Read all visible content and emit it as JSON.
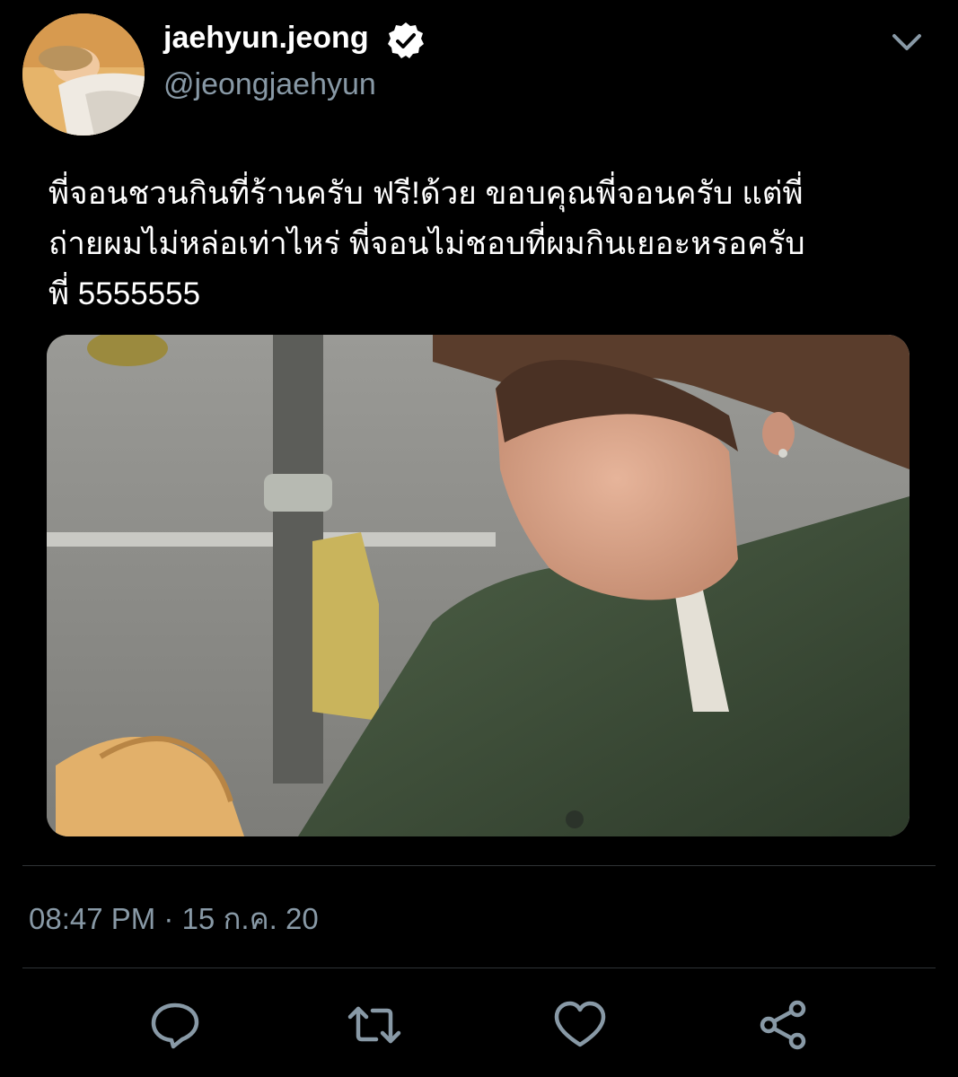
{
  "profile": {
    "display_name": "jaehyun.jeong",
    "username": "@jeongjaehyun",
    "verified": true,
    "avatar_icon": "user-avatar-photo"
  },
  "tweet": {
    "lines": [
      "พี่จอนชวนกินที่ร้านครับ ฟรี!ด้วย ขอบคุณพี่จอนครับ แต่พี่",
      "ถ่ายผมไม่หล่อเท่าไหร่  พี่จอนไม่ชอบที่ผมกินเยอะหรอครับ",
      "พี่ 5555555"
    ],
    "media_icon": "photo-of-person-in-denim-jacket"
  },
  "meta": {
    "timestamp": "08:47 PM · 15 ก.ค. 20"
  },
  "actions": {
    "icons": [
      "reply-icon",
      "retweet-icon",
      "like-icon",
      "share-icon"
    ]
  },
  "colors": {
    "background": "#000000",
    "text_primary": "#ffffff",
    "text_secondary": "#8899a6",
    "divider": "#2f3336"
  }
}
